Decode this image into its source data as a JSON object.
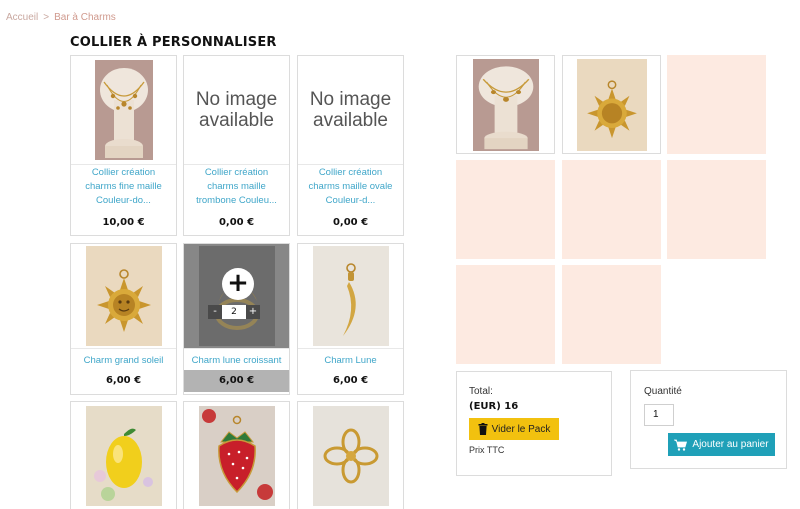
{
  "breadcrumb": {
    "home": "Accueil",
    "separator": ">",
    "current": "Bar à Charms"
  },
  "page_title": "COLLIER À PERSONNALISER",
  "no_image_text": "No image available",
  "products": [
    {
      "name": "Collier création charms fine maille Couleur-do...",
      "price": "10,00 €",
      "image": "necklace-bust-photo"
    },
    {
      "name": "Collier création charms maille trombone Couleu...",
      "price": "0,00 €",
      "image": "no-image"
    },
    {
      "name": "Collier création charms maille ovale Couleur-d...",
      "price": "0,00 €",
      "image": "no-image"
    },
    {
      "name": "Charm grand soleil",
      "price": "6,00 €",
      "image": "sun-charm-photo"
    },
    {
      "name": "Charm lune croissant",
      "price": "6,00 €",
      "image": "crescent-moon-charm-photo",
      "hover": {
        "plus": "+",
        "minus": "-",
        "qty": "2",
        "inc": "+"
      }
    },
    {
      "name": "Charm Lune",
      "price": "6,00 €",
      "image": "moon-charm-photo"
    },
    {
      "name": "",
      "price": "",
      "image": "lemon-charm-photo"
    },
    {
      "name": "",
      "price": "",
      "image": "strawberry-charm-photo"
    },
    {
      "name": "",
      "price": "",
      "image": "flower-charm-photo"
    }
  ],
  "pack": {
    "items": [
      "necklace-bust-photo",
      "sun-charm-photo"
    ],
    "empty_slots": 6,
    "total_label": "Total:",
    "total_value": "(EUR) 16",
    "clear_button": "Vider le Pack",
    "tax_note": "Prix TTC"
  },
  "cart": {
    "quantity_label": "Quantité",
    "quantity_value": "1",
    "add_button": "Ajouter au panier"
  },
  "colors": {
    "link": "#3fa6c9",
    "slot": "#fdeae1",
    "clear_button": "#f2c10f",
    "cart_button": "#1fa0b8",
    "breadcrumb": "#d09a8e"
  }
}
